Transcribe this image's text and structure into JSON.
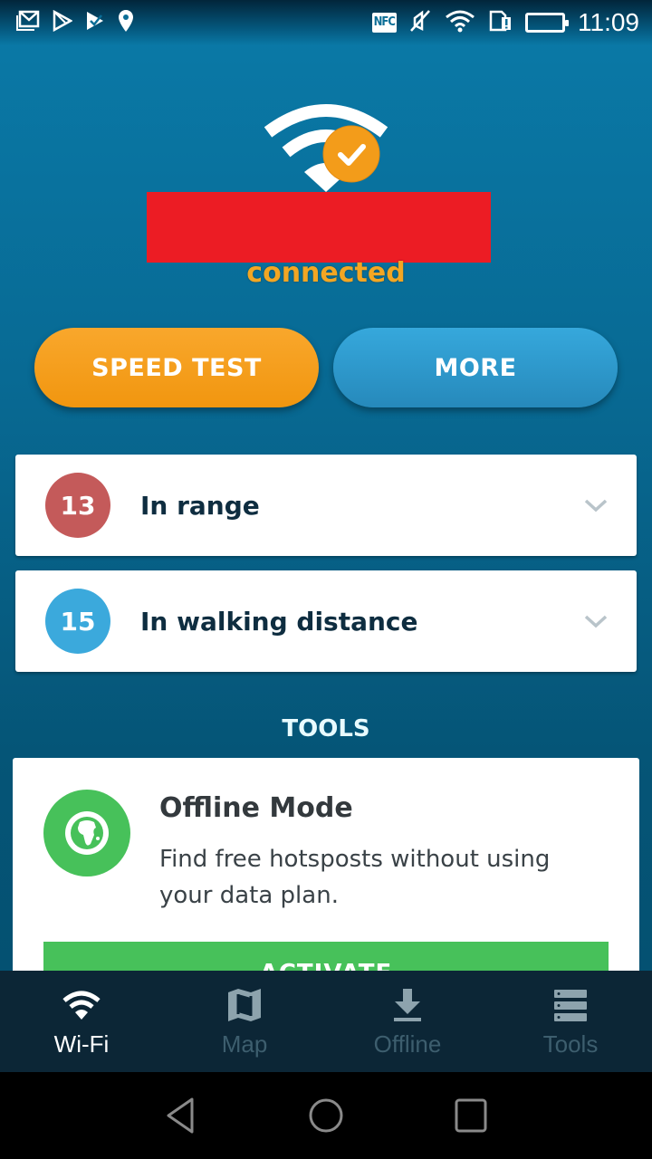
{
  "status_bar": {
    "left_icons": [
      "gmail-icon",
      "play-store-icon",
      "play-check-icon",
      "location-icon"
    ],
    "right_icons": [
      "nfc-icon",
      "mute-icon",
      "wifi-signal-icon",
      "sim-alert-icon",
      "battery-icon"
    ],
    "nfc_label": "NFC",
    "time": "11:09"
  },
  "hero": {
    "icon": "wifi-connected-icon",
    "network_name": "[redacted]",
    "status": "connected"
  },
  "actions": {
    "speed_test": "SPEED TEST",
    "more": "MORE"
  },
  "hotspot_groups": [
    {
      "count": "13",
      "label": "In range",
      "color": "#c45a5a"
    },
    {
      "count": "15",
      "label": "In walking distance",
      "color": "#3ba9dc"
    }
  ],
  "tools": {
    "section_title": "TOOLS",
    "cards": [
      {
        "icon": "globe-icon",
        "title": "Offline Mode",
        "description": "Find free hotsposts without using your data plan.",
        "button": "ACTIVATE"
      }
    ]
  },
  "bottom_nav": {
    "items": [
      {
        "label": "Wi-Fi",
        "icon": "wifi-icon",
        "active": true
      },
      {
        "label": "Map",
        "icon": "map-icon",
        "active": false
      },
      {
        "label": "Offline",
        "icon": "download-icon",
        "active": false
      },
      {
        "label": "Tools",
        "icon": "tools-list-icon",
        "active": false
      }
    ]
  },
  "system_nav": [
    "back",
    "home",
    "recents"
  ],
  "colors": {
    "accent_orange": "#f5a01e",
    "accent_blue": "#2f9ccf",
    "success_green": "#47c15a",
    "nav_bg": "#0c2636"
  }
}
